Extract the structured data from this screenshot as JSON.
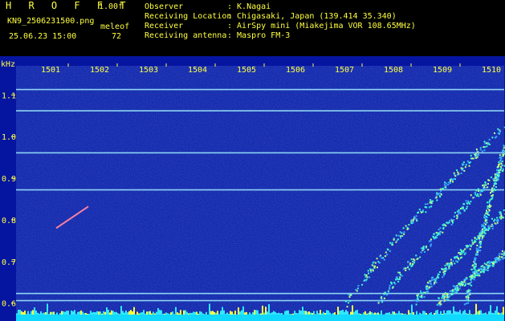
{
  "header": {
    "app_title": "H R O F F T",
    "version": "1.00f",
    "filename": "KN9_25062315​00.png",
    "datetime": "25.06.23 15:00",
    "meleof_label": "meleof",
    "meleof_value": "72",
    "fields": [
      {
        "label": "Observer",
        "value": ": K.Nagai"
      },
      {
        "label": "Receiving Location",
        "value": ": Chigasaki, Japan (139.414 35.340)"
      },
      {
        "label": "Receiver",
        "value": ": AirSpy mini (Miakejima VOR 108.65MHz)"
      },
      {
        "label": "Receiving antenna",
        "value": ": Maspro FM-3"
      }
    ]
  },
  "colors": {
    "background_noise": "#0a1ea0",
    "label_yellow": "#ffff40",
    "carrier_line": "#a0f0ff",
    "baseline": "#00ffff"
  },
  "chart_data": {
    "type": "heatmap",
    "yunit": "kHz",
    "xlabels": [
      "1501",
      "1502",
      "1503",
      "1504",
      "1505",
      "1506",
      "1507",
      "1508",
      "1509",
      "1510"
    ],
    "yticks": [
      "1.1",
      "1.0",
      "0.9",
      "0.8",
      "0.7",
      "0.6"
    ],
    "ylim": [
      0.58,
      1.17
    ],
    "carrier_lines_khz": [
      1.113,
      1.062,
      0.961,
      0.872,
      0.623,
      0.606
    ],
    "meteor_echo_khz": [
      [
        0.78,
        0.832
      ]
    ],
    "grid": false
  }
}
